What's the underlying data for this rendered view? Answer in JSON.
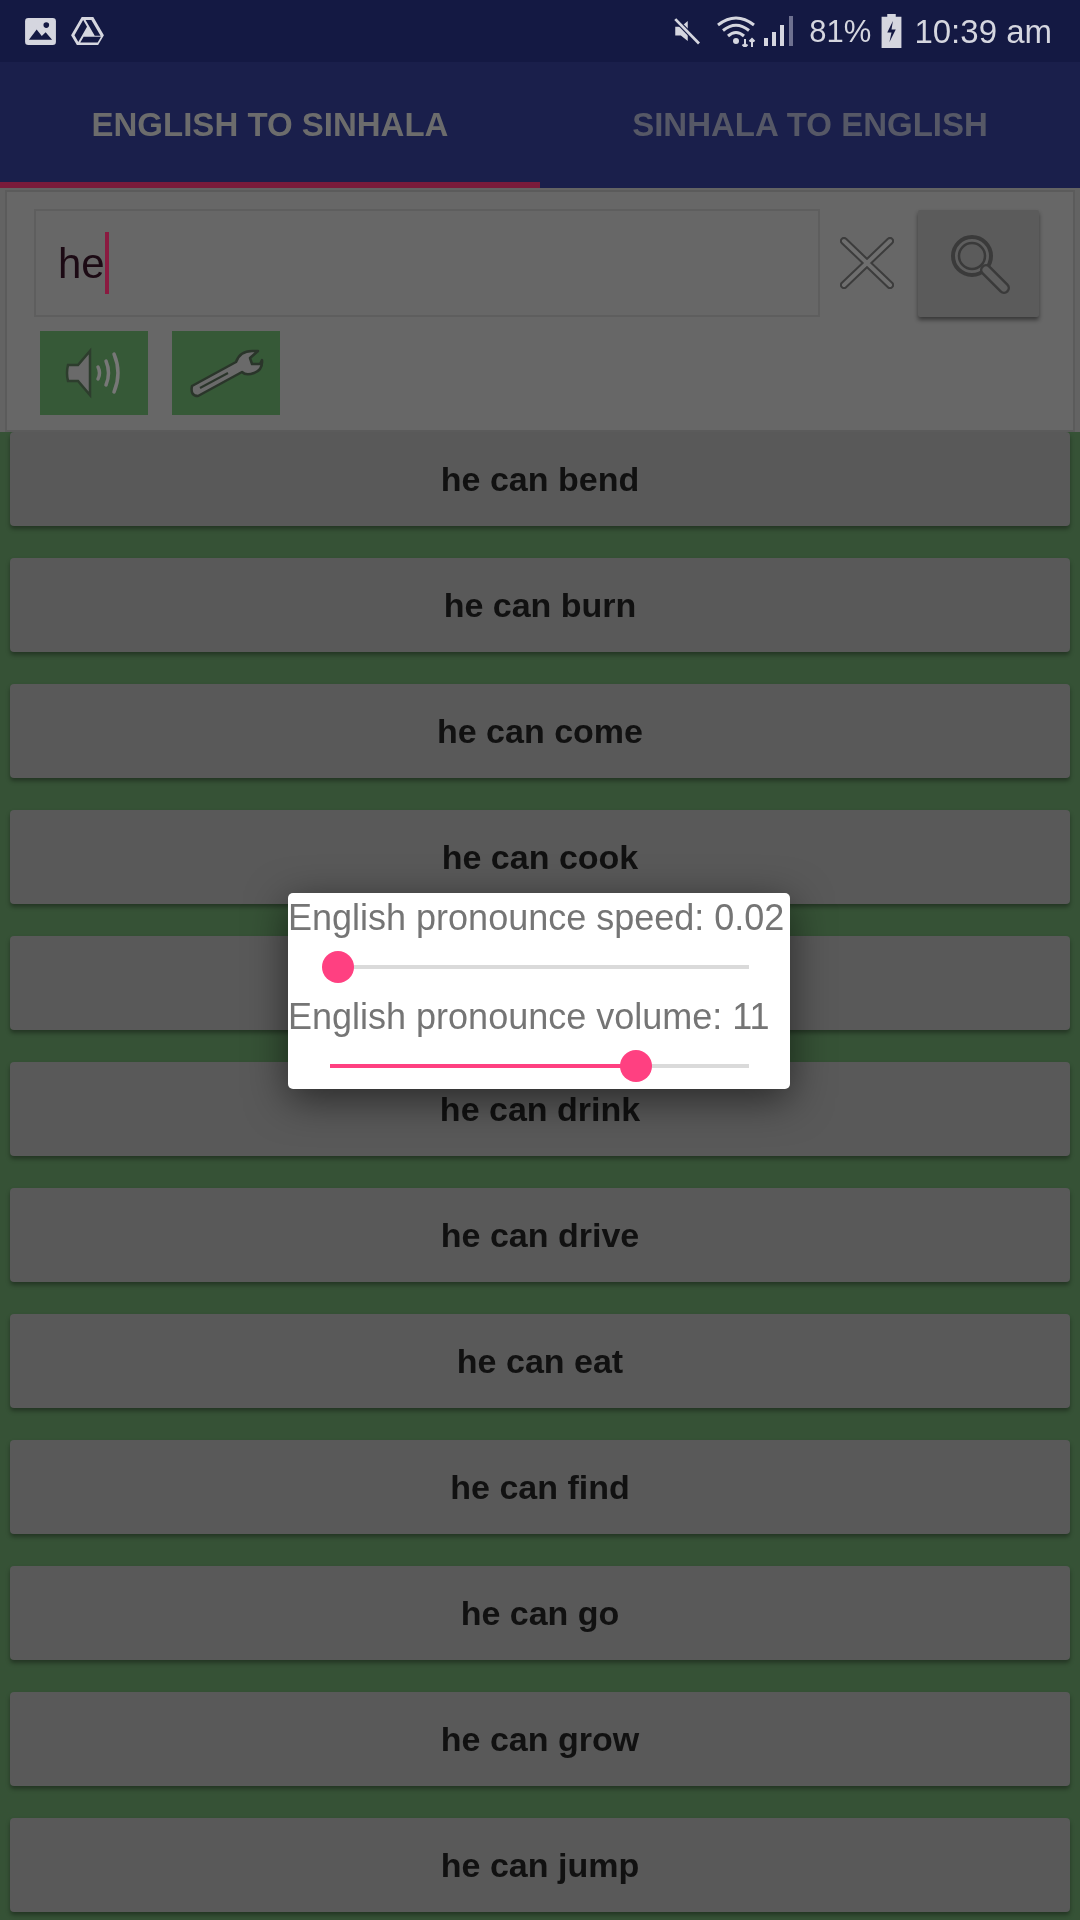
{
  "status_bar": {
    "battery": "81%",
    "time": "10:39 am"
  },
  "tabs": [
    {
      "label": "ENGLISH TO SINHALA",
      "selected": true
    },
    {
      "label": "SINHALA TO ENGLISH",
      "selected": false
    }
  ],
  "search": {
    "value": "he"
  },
  "results": [
    {
      "kind": "text",
      "label": "he can bend"
    },
    {
      "kind": "text",
      "label": "he can burn"
    },
    {
      "kind": "text",
      "label": "he can come"
    },
    {
      "kind": "text",
      "label": "he can cook"
    },
    {
      "kind": "covered"
    },
    {
      "kind": "text",
      "label": "he can drink"
    },
    {
      "kind": "text",
      "label": "he can drive"
    },
    {
      "kind": "text",
      "label": "he can eat"
    },
    {
      "kind": "text",
      "label": "he can find"
    },
    {
      "kind": "text",
      "label": "he can go"
    },
    {
      "kind": "text",
      "label": "he can grow"
    },
    {
      "kind": "text",
      "label": "he can jump"
    }
  ],
  "dialog": {
    "sliders": [
      {
        "label": "English pronounce speed: 0.02",
        "level": 0.02
      },
      {
        "label": "English pronounce volume: 11",
        "level": 0.73
      }
    ]
  }
}
